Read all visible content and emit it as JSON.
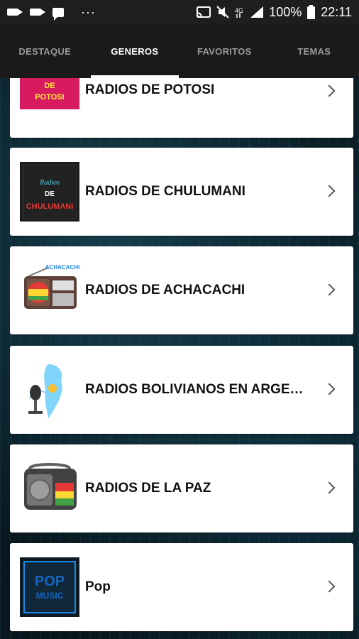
{
  "status_bar": {
    "battery": "100%",
    "time": "22:11",
    "dots": "···"
  },
  "tabs": [
    {
      "label": "DESTAQUE",
      "active": false
    },
    {
      "label": "GENEROS",
      "active": true
    },
    {
      "label": "FAVORITOS",
      "active": false
    },
    {
      "label": "TEMAS",
      "active": false
    }
  ],
  "items": [
    {
      "title": "RADIOS DE POTOSI",
      "thumb_text": "DE POTOSI",
      "icon": "potosi-logo-icon"
    },
    {
      "title": "RADIOS DE CHULUMANI",
      "thumb_text_1": "Radios",
      "thumb_text_2": "DE",
      "thumb_text_3": "CHULUMANI",
      "icon": "chulumani-logo-icon"
    },
    {
      "title": "RADIOS DE ACHACACHI",
      "thumb_text": "ACHACACHI",
      "icon": "achacachi-radio-icon"
    },
    {
      "title": "RADIOS BOLIVIANOS EN ARGENTINA",
      "icon": "argentina-microphone-icon"
    },
    {
      "title": "RADIOS DE LA PAZ",
      "icon": "la-paz-radio-icon"
    },
    {
      "title": "Pop",
      "thumb_text_1": "POP",
      "thumb_text_2": "MUSIC",
      "icon": "pop-music-icon"
    }
  ]
}
